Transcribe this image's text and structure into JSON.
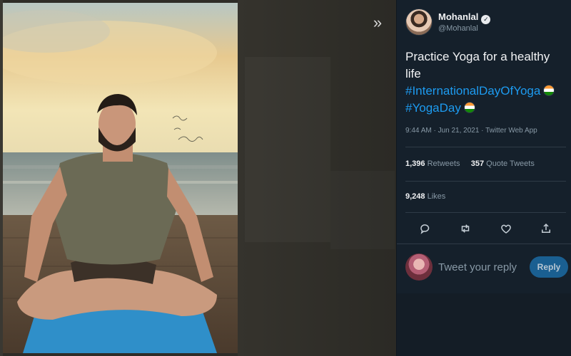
{
  "viewer": {
    "expand_icon": "double-chevron-right-icon"
  },
  "tweet": {
    "author_name": "Mohanlal",
    "author_handle": "@Mohanlal",
    "text": "Practice Yoga for a healthy life",
    "hashtags": [
      "#InternationalDayOfYoga",
      "#YogaDay"
    ],
    "timestamp": "9:44 AM · Jun 21, 2021 · Twitter Web App",
    "retweets_count": "1,396",
    "retweets_label": "Retweets",
    "quote_count": "357",
    "quote_label": "Quote Tweets",
    "likes_count": "9,248",
    "likes_label": "Likes"
  },
  "actions": {
    "icons": [
      "reply-icon",
      "retweet-icon",
      "like-icon",
      "share-icon"
    ]
  },
  "reply": {
    "placeholder": "Tweet your reply",
    "button_label": "Reply"
  },
  "colors": {
    "background": "#15202b",
    "accent": "#1d9bf0",
    "muted_text": "#8899a6"
  }
}
